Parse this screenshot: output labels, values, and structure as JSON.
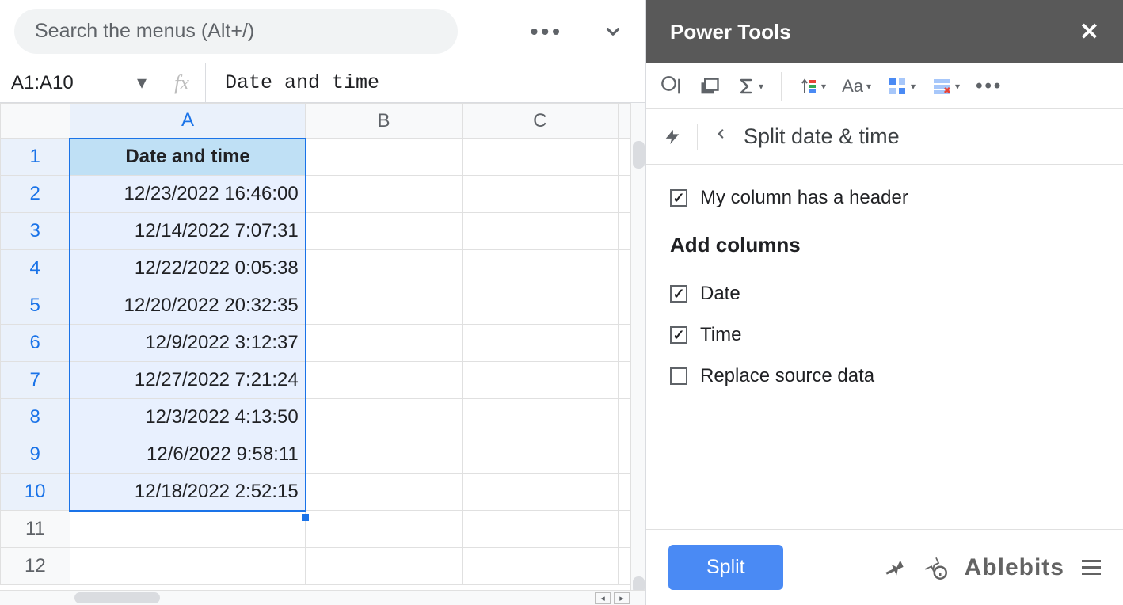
{
  "search": {
    "placeholder": "Search the menus (Alt+/)"
  },
  "namebox": "A1:A10",
  "formula": "Date and time",
  "columns": [
    "A",
    "B",
    "C"
  ],
  "rows": [
    "1",
    "2",
    "3",
    "4",
    "5",
    "6",
    "7",
    "8",
    "9",
    "10",
    "11",
    "12"
  ],
  "headerCell": "Date and time",
  "data": [
    "12/23/2022 16:46:00",
    "12/14/2022 7:07:31",
    "12/22/2022 0:05:38",
    "12/20/2022 20:32:35",
    "12/9/2022 3:12:37",
    "12/27/2022 7:21:24",
    "12/3/2022 4:13:50",
    "12/6/2022 9:58:11",
    "12/18/2022 2:52:15"
  ],
  "sidebar": {
    "title": "Power Tools",
    "breadcrumb": "Split date & time",
    "chk_header": "My column has a header",
    "section": "Add columns",
    "chk_date": "Date",
    "chk_time": "Time",
    "chk_replace": "Replace source data",
    "split_btn": "Split",
    "brand": "Ablebits"
  }
}
